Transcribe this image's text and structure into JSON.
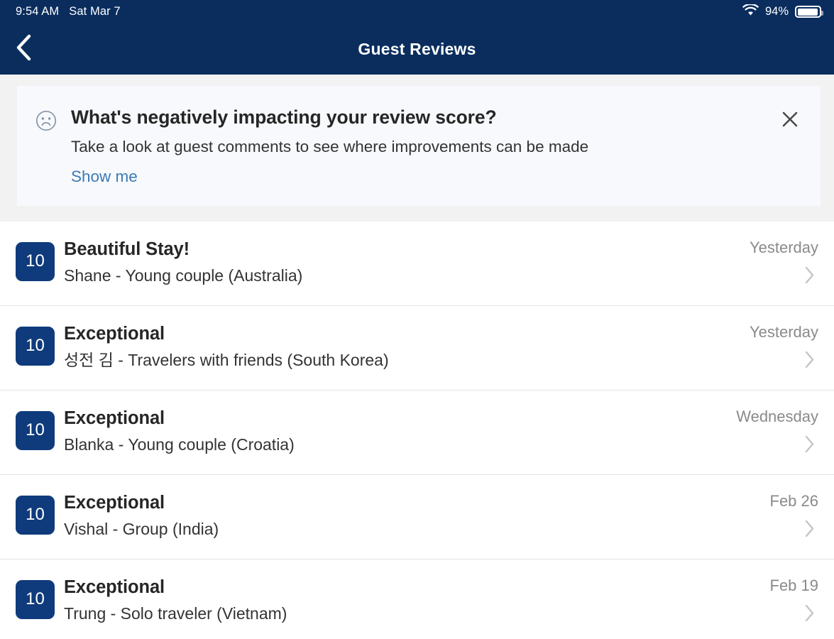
{
  "status_bar": {
    "time": "9:54 AM",
    "date": "Sat Mar 7",
    "wifi_icon": "wifi-icon",
    "battery_percent": "94%",
    "battery_icon": "battery-icon"
  },
  "nav": {
    "back_icon": "chevron-left-icon",
    "title": "Guest Reviews"
  },
  "banner": {
    "icon": "sad-face-icon",
    "title": "What's negatively impacting your review score?",
    "text": "Take a look at guest comments to see where improvements can be made",
    "link_label": "Show me",
    "close_icon": "close-icon",
    "background_color": "#f7f9fc",
    "link_color": "#3d7ab5"
  },
  "colors": {
    "nav_background": "#0a2d5e",
    "page_background": "#f2f2f2",
    "badge_background": "#0f3b7c",
    "row_background": "#ffffff",
    "divider": "#e4e4e4"
  },
  "reviews": [
    {
      "score": "10",
      "title": "Beautiful Stay!",
      "subtitle": "Shane - Young couple (Australia)",
      "date": "Yesterday",
      "chevron_icon": "chevron-right-icon"
    },
    {
      "score": "10",
      "title": "Exceptional",
      "subtitle": "성전 김 - Travelers with friends (South Korea)",
      "date": "Yesterday",
      "chevron_icon": "chevron-right-icon"
    },
    {
      "score": "10",
      "title": "Exceptional",
      "subtitle": "Blanka - Young couple (Croatia)",
      "date": "Wednesday",
      "chevron_icon": "chevron-right-icon"
    },
    {
      "score": "10",
      "title": "Exceptional",
      "subtitle": "Vishal - Group (India)",
      "date": "Feb 26",
      "chevron_icon": "chevron-right-icon"
    },
    {
      "score": "10",
      "title": "Exceptional",
      "subtitle": "Trung - Solo traveler (Vietnam)",
      "date": "Feb 19",
      "chevron_icon": "chevron-right-icon"
    }
  ]
}
